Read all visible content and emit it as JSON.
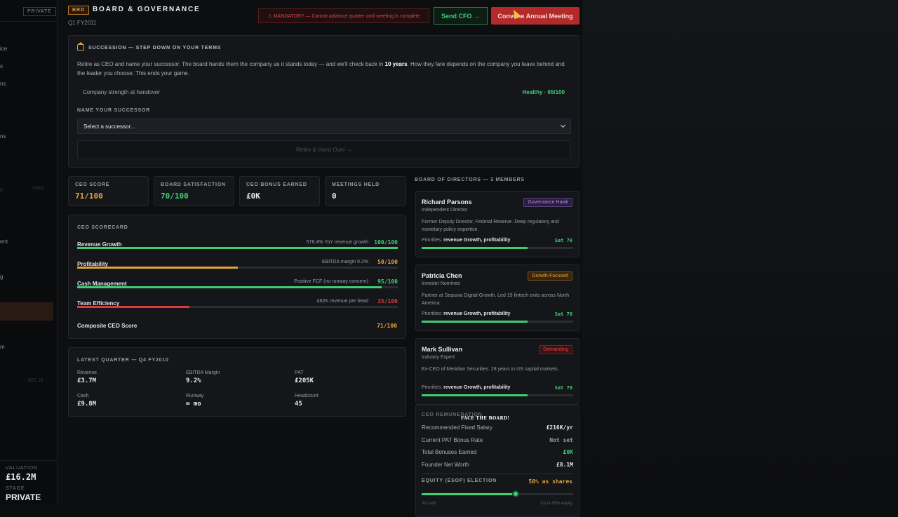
{
  "sidebar": {
    "badge": "PRIVATE",
    "fragments": [
      "ice",
      "s",
      "ns",
      "ns",
      "ent",
      "g",
      "m"
    ],
    "dim_fragments": [
      "s",
      "10000",
      "REC 18"
    ],
    "valuation_label": "VALUATION",
    "valuation_value": "£16.2M",
    "stage_label": "STAGE",
    "stage_value": "PRIVATE"
  },
  "header": {
    "tag": "BRD",
    "title": "BOARD & GOVERNANCE",
    "subtitle": "Q1 FY2011",
    "mandatory_notice": "⚠ MANDATORY — Cannot advance quarter until meeting is complete",
    "send_cfo_label": "Send CFO →",
    "convene_label": "Convene Annual Meeting"
  },
  "succession": {
    "heading": "SUCCESSION — STEP DOWN ON YOUR TERMS",
    "text_1": "Retire as CEO and name your successor. The board hands them the company as it stands today — and we'll check back in ",
    "text_bold": "10 years",
    "text_2": ". How they fare depends on the company you leave behind and the leader you choose. This ends your game.",
    "strength_label": "Company strength at handover",
    "strength_value": "Healthy · 65/100",
    "successor_label": "NAME YOUR SUCCESSOR",
    "successor_placeholder": "Select a successor...",
    "retire_label": "Retire & Hand Over →"
  },
  "stats": [
    {
      "label": "CEO SCORE",
      "value": "71/100",
      "color": "#e0a53a"
    },
    {
      "label": "BOARD SATISFACTION",
      "value": "70/100",
      "color": "#3ecf74"
    },
    {
      "label": "CEO BONUS EARNED",
      "value": "£0K",
      "color": "#e8e9eb"
    },
    {
      "label": "MEETINGS HELD",
      "value": "0",
      "color": "#e8e9eb"
    }
  ],
  "scorecard": {
    "title": "CEO SCORECARD",
    "rows": [
      {
        "name": "Revenue Growth",
        "note": "576.4% YoY revenue growth",
        "value": "100/100",
        "fraction": 1.0,
        "color": "#3ecf74"
      },
      {
        "name": "Profitability",
        "note": "EBITDA margin 9.2%",
        "value": "50/100",
        "fraction": 0.5,
        "color": "#e0a53a"
      },
      {
        "name": "Cash Management",
        "note": "Positive FCF (no runway concern)",
        "value": "95/100",
        "fraction": 0.95,
        "color": "#3ecf74"
      },
      {
        "name": "Team Efficiency",
        "note": "£82K revenue per head",
        "value": "35/100",
        "fraction": 0.35,
        "color": "#d93b3b"
      }
    ],
    "composite_label": "Composite CEO Score",
    "composite_value": "71/100"
  },
  "latest_quarter": {
    "title": "LATEST QUARTER — Q4 FY2010",
    "cells": [
      {
        "label": "Revenue",
        "value": "£3.7M"
      },
      {
        "label": "EBITDA Margin",
        "value": "9.2%"
      },
      {
        "label": "PAT",
        "value": "£205K"
      },
      {
        "label": "Cash",
        "value": "£9.8M"
      },
      {
        "label": "Runway",
        "value": "∞ mo"
      },
      {
        "label": "Headcount",
        "value": "45"
      }
    ]
  },
  "board": {
    "title": "BOARD OF DIRECTORS — 3 MEMBERS",
    "directors": [
      {
        "name": "Richard Parsons",
        "role": "Independent Director",
        "tag": "Governance Hawk",
        "tag_color": "#b58cf0",
        "tag_bg": "#2a1d3d",
        "bio": "Former Deputy Director, Federal Reserve. Deep regulatory and monetary policy expertise.",
        "priorities_label": "Priorities:",
        "priorities": "revenue Growth, profitability",
        "sat": "Sat 70",
        "sat_fraction": 0.7
      },
      {
        "name": "Patricia Chen",
        "role": "Investor Nominee",
        "tag": "Growth-Focused",
        "tag_color": "#e0a53a",
        "tag_bg": "#3a2610",
        "bio": "Partner at Sequoia Digital Growth. Led 15 fintech exits across North America.",
        "priorities_label": "Priorities:",
        "priorities": "revenue Growth, profitability",
        "sat": "Sat 70",
        "sat_fraction": 0.7
      },
      {
        "name": "Mark Sullivan",
        "role": "Industry Expert",
        "tag": "Demanding",
        "tag_color": "#e04646",
        "tag_bg": "#3a1214",
        "bio": "Ex-CEO of Meridian Securities. 28 years in US capital markets.",
        "priorities_label": "Priorities:",
        "priorities": "revenue Growth, profitability",
        "sat": "Sat 70",
        "sat_fraction": 0.7
      }
    ]
  },
  "remuneration": {
    "title": "CEO REMUNERATION",
    "overlay": "FACE THE BOARD!",
    "rows": [
      {
        "label": "Recommended Fixed Salary",
        "value": "£216K/yr",
        "color": "#e8e9eb"
      },
      {
        "label": "Current PAT Bonus Rate",
        "value": "Not set",
        "color": "#9a9da3"
      },
      {
        "label": "Total Bonuses Earned",
        "value": "£0K",
        "color": "#3ecf74"
      },
      {
        "label": "Founder Net Worth",
        "value": "£8.1M",
        "color": "#e8e9eb"
      }
    ],
    "equity_label": "EQUITY (ESOP) ELECTION",
    "equity_value": "50% as shares",
    "equity_fraction": 0.62,
    "slider_min_label": "All cash",
    "slider_max_label": "Up to 80% equity"
  }
}
